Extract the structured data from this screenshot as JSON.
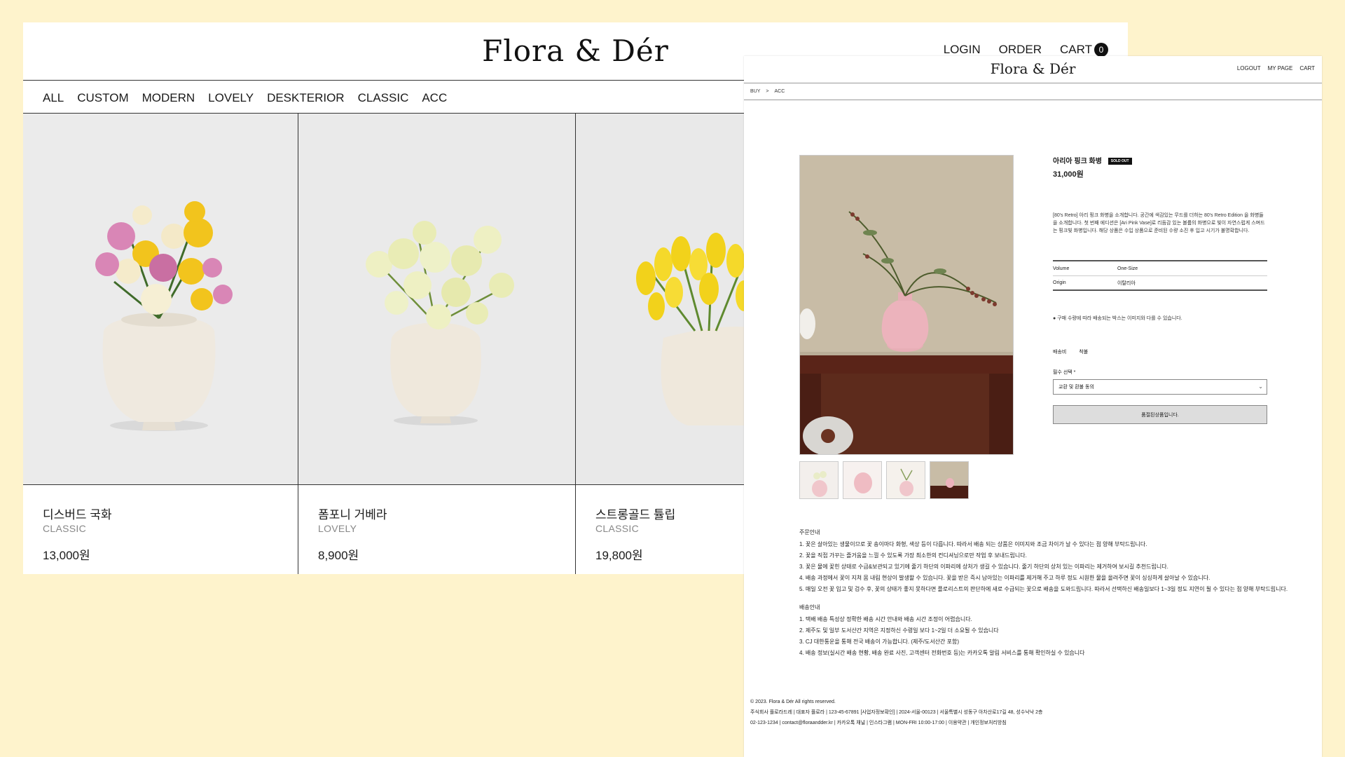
{
  "listing": {
    "logo": "Flora & Dér",
    "util": {
      "login": "LOGIN",
      "order": "ORDER",
      "cart": "CART",
      "cart_count": "0"
    },
    "nav": [
      "ALL",
      "CUSTOM",
      "MODERN",
      "LOVELY",
      "DESKTERIOR",
      "CLASSIC",
      "ACC"
    ],
    "products": [
      {
        "name": "디스버드 국화",
        "category": "CLASSIC",
        "price": "13,000원"
      },
      {
        "name": "폼포니 거베라",
        "category": "LOVELY",
        "price": "8,900원"
      },
      {
        "name": "스트롱골드 튤립",
        "category": "CLASSIC",
        "price": "19,800원"
      }
    ]
  },
  "detail": {
    "logo": "Flora & Dér",
    "util": {
      "logout": "LOGOUT",
      "mypage": "MY PAGE",
      "cart": "CART"
    },
    "breadcrumb": [
      "BUY",
      ">",
      "ACC"
    ],
    "product": {
      "name": "아리아 핑크 화병",
      "badge": "SOLD OUT",
      "price": "31,000원",
      "description": "[80's Retro] 아리 핑크 화병을 소개합니다. 공간에 색감있는 무드를 더하는 80's Retro Edition 을 화병들을 소개합니다. 첫 번째 에디션은 [Ari Pink Vase]로 리듬감 있는 볼륨의 화병으로 빛이 자연스럽게 스며드는 핑크빛 화병입니다. 해당 상품은 수입 상품으로 준비된 수량 소진 후 입고 시기가 불명확합니다.",
      "specs": [
        {
          "key": "Volume",
          "value": "One-Size"
        },
        {
          "key": "Origin",
          "value": "이탈리아"
        }
      ],
      "notice": "● 구매 수량에 따라 배송되는 박스는 이미지와 다를 수 있습니다.",
      "shipping_label": "배송비",
      "shipping_value": "착불",
      "option_label": "필수 선택 *",
      "option_selected": "교환 및 환불 동의",
      "button": "품절된상품입니다."
    },
    "order_info": {
      "title": "주문안내",
      "items": [
        "1. 꽃은 살아있는 생물이므로 꽃 송이마다 화형, 색상 등이 다릅니다. 따라서 배송 되는 상품은 이미지와 조금 차이가 날 수 있다는 점 양해 부탁드립니다.",
        "2. 꽃을 직접 가꾸는 즐거움을 느낄 수 있도록 가장 최소한의 컨디셔닝으로만 작업 후 보내드립니다.",
        "3. 꽃은 물에 꽂힌 상태로 수급&보관되고 있기에 줄기 하단의 이파리에 상처가 생길 수 있습니다. 줄기 하단의 상처 있는 이파리는 제거하여 보시길 추천드립니다.",
        "4. 배송 과정에서 꽃이 지쳐 몸 내림 현상이 발생할 수 있습니다. 꽃을 받은 즉시 남아있는 이파리를 제거해 주고 하루 정도 시원한 물을 올려주면 꽃이 싱싱하게 살아날 수 있습니다.",
        "5. 매일 오전 꽃 입고 및 검수 후, 꽃의 상태가 좋지 못하다면 플로리스트의 판단하에 새로 수급되는 꽃으로 배송을 도와드립니다. 따라서 선택하신 배송일보다 1~3일 정도 지연이 될 수 있다는 점 양해 부탁드립니다."
      ]
    },
    "delivery_info": {
      "title": "배송안내",
      "items": [
        "1. 택배 배송 특성상 정확한 배송 시간 안내와 배송 시간 조정이 어렵습니다.",
        "2. 제주도 및 일부 도서산간 지역은 지정하신 수령일 보다 1~2일 더 소요될 수 있습니다",
        "3. CJ 대한통운을 통해 전국 배송이 가능합니다. (제주/도서산간 포함)",
        "4. 배송 정보(실시간 배송 현황, 배송 완료 사진, 고객센터 전화번호 등)는 카카오톡 알림 서비스를 통해 확인하실 수 있습니다"
      ]
    },
    "footer": {
      "copyright": "© 2023. Flora & Dér All rights reserved.",
      "company": "주식회사 플로라드레 | 대표자 플로라 | 123-45-67891 [사업자정보확인] | 2024-서울-00123 | 서울특별시 성동구 아차산로17길 48, 성수낙낙 2층",
      "contact": "02-123-1234  |  contact@floraandder.kr  |  카카오톡 채널  |  인스타그램 | MON-FRI 10:00-17:00 | 이용약관  |  개인정보처리방침"
    }
  }
}
